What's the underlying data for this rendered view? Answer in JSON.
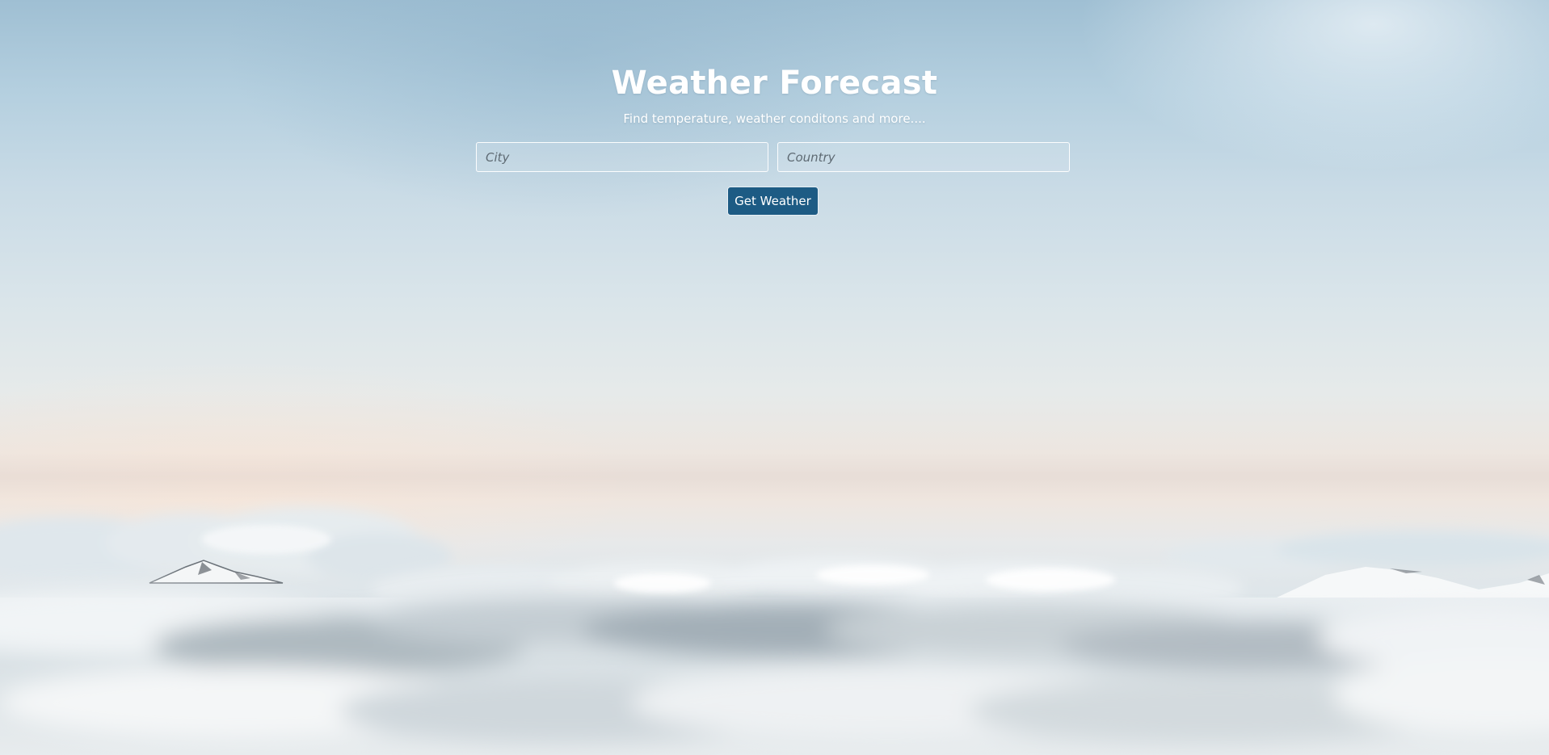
{
  "header": {
    "title": "Weather Forecast",
    "subtitle": "Find temperature, weather conditons and more...."
  },
  "form": {
    "city_placeholder": "City",
    "country_placeholder": "Country",
    "submit_label": "Get Weather"
  },
  "colors": {
    "button_background": "#1d5b84",
    "text": "#ffffff"
  }
}
